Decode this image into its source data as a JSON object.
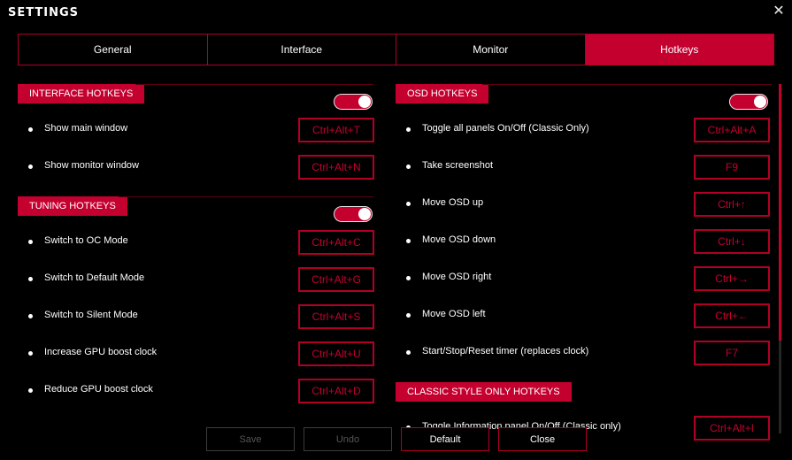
{
  "window": {
    "title": "SETTINGS",
    "close_glyph": "✕"
  },
  "tabs": [
    {
      "label": "General"
    },
    {
      "label": "Interface"
    },
    {
      "label": "Monitor"
    },
    {
      "label": "Hotkeys",
      "active": true
    }
  ],
  "interface_hotkeys": {
    "heading": "INTERFACE HOTKEYS",
    "enabled": true,
    "items": [
      {
        "label": "Show main window",
        "key": "Ctrl+Alt+T"
      },
      {
        "label": "Show monitor window",
        "key": "Ctrl+Alt+N"
      }
    ]
  },
  "tuning_hotkeys": {
    "heading": "TUNING HOTKEYS",
    "enabled": true,
    "items": [
      {
        "label": "Switch to OC Mode",
        "key": "Ctrl+Alt+C"
      },
      {
        "label": "Switch to Default Mode",
        "key": "Ctrl+Alt+G"
      },
      {
        "label": "Switch to Silent Mode",
        "key": "Ctrl+Alt+S"
      },
      {
        "label": "Increase GPU boost clock",
        "key": "Ctrl+Alt+U"
      },
      {
        "label": "Reduce GPU boost clock",
        "key": "Ctrl+Alt+D"
      }
    ]
  },
  "osd_hotkeys": {
    "heading": "OSD HOTKEYS",
    "enabled": true,
    "items": [
      {
        "label": "Toggle all panels On/Off (Classic Only)",
        "key": "Ctrl+Alt+A"
      },
      {
        "label": "Take screenshot",
        "key": "F9"
      },
      {
        "label": "Move OSD up",
        "key": "Ctrl+↑"
      },
      {
        "label": "Move OSD down",
        "key": "Ctrl+↓"
      },
      {
        "label": "Move OSD right",
        "key": "Ctrl+→"
      },
      {
        "label": "Move OSD left",
        "key": "Ctrl+←"
      },
      {
        "label": "Start/Stop/Reset timer (replaces clock)",
        "key": "F7"
      }
    ]
  },
  "classic_hotkeys": {
    "heading": "CLASSIC STYLE ONLY HOTKEYS",
    "items": [
      {
        "label": "Toggle Information panel On/Off (Classic only)",
        "key": "Ctrl+Alt+I"
      }
    ]
  },
  "footer": {
    "save": "Save",
    "undo": "Undo",
    "default": "Default",
    "close": "Close"
  },
  "colors": {
    "accent": "#c4002f",
    "border": "#b00025",
    "background": "#000000",
    "text": "#ffffff",
    "disabled": "#555555"
  },
  "icons": {
    "close": "close-icon",
    "bullet": "bullet-icon"
  }
}
